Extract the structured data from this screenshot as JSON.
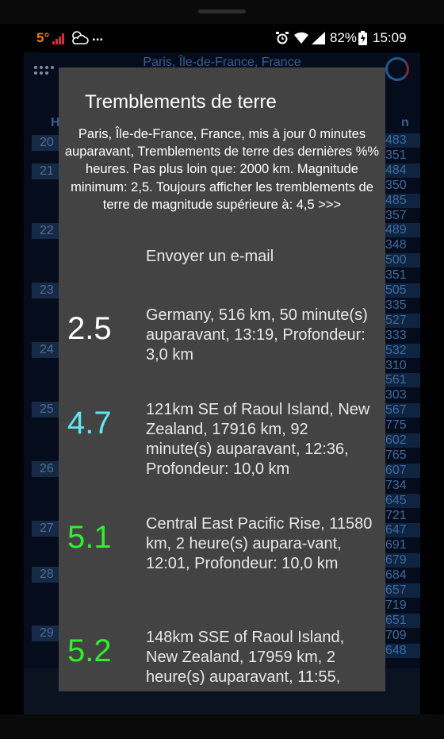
{
  "status_bar": {
    "temperature": "5°",
    "dots": "...",
    "battery_pct": "82%",
    "time": "15:09"
  },
  "background_app": {
    "location": "Paris, Île-de-France, France",
    "hours": [
      "20",
      "21",
      "22",
      "23",
      "24",
      "25",
      "26",
      "27",
      "28",
      "29"
    ],
    "values": [
      "483",
      "351",
      "484",
      "350",
      "485",
      "357",
      "489",
      "348",
      "500",
      "351",
      "505",
      "335",
      "527",
      "333",
      "532",
      "310",
      "561",
      "303",
      "567",
      "775",
      "602",
      "765",
      "607",
      "734",
      "645",
      "721",
      "647",
      "691",
      "679",
      "684",
      "657",
      "719",
      "651",
      "709",
      "648"
    ]
  },
  "dialog": {
    "title": "Tremblements de terre",
    "subtitle": "Paris, Île-de-France, France, mis à jour 0 minutes auparavant, Tremblements de terre des dernières %% heures. Pas plus loin que: 2000 km. Magnitude minimum: 2,5. Toujours afficher les tremblements de terre de magnitude supérieure à: 4,5 >>>",
    "email_label": "Envoyer un e-mail",
    "quakes": [
      {
        "magnitude": "2.5",
        "color": "#ffffff",
        "description": "Germany, 516 km, 50 minute(s) auparavant, 13:19, Profondeur: 3,0 km"
      },
      {
        "magnitude": "4.7",
        "color": "#5ce7f2",
        "description": "121km SE of Raoul Island, New Zealand, 17916 km, 92 minute(s) auparavant, 12:36, Profondeur: 10,0 km"
      },
      {
        "magnitude": "5.1",
        "color": "#2ff02a",
        "description": "Central East Pacific Rise, 11580 km, 2 heure(s) aupara-vant, 12:01, Profondeur: 10,0 km"
      },
      {
        "magnitude": "5.2",
        "color": "#2ff02a",
        "description": "148km SSE of Raoul Island, New Zealand, 17959 km, 2 heure(s) auparavant, 11:55,"
      }
    ]
  }
}
